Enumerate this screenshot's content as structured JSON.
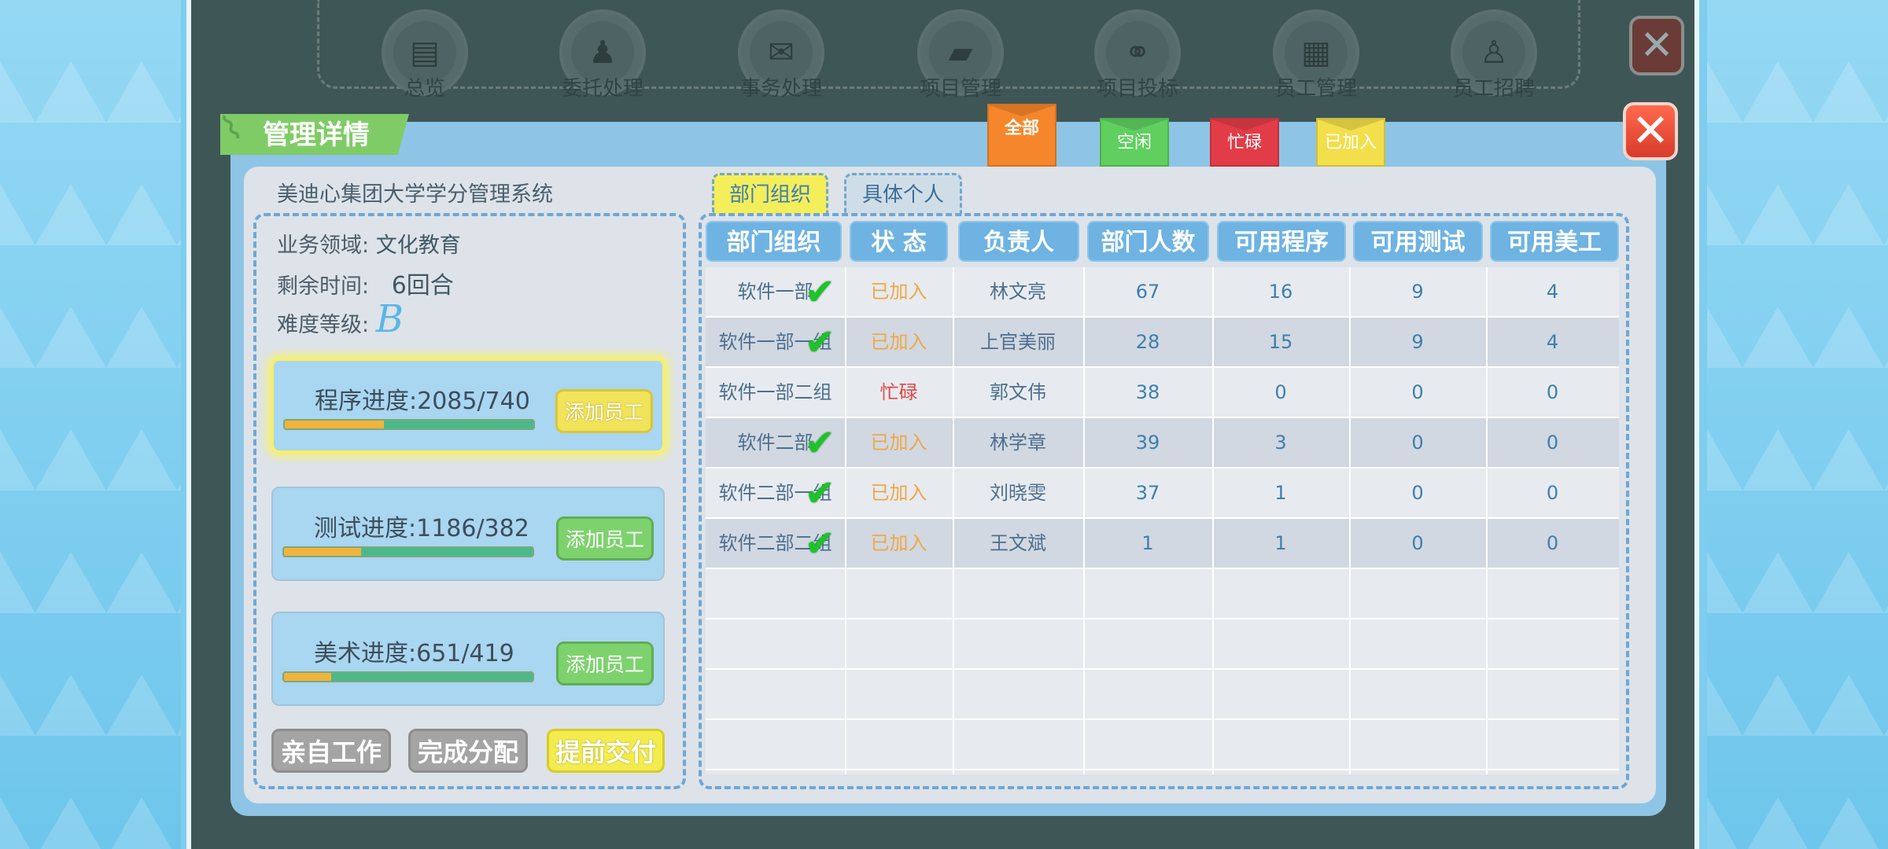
{
  "nav": {
    "items": [
      {
        "label": "总览",
        "icon": "clipboard-icon"
      },
      {
        "label": "委托处理",
        "icon": "businessman-icon"
      },
      {
        "label": "事务处理",
        "icon": "chat-icon"
      },
      {
        "label": "项目管理",
        "icon": "folder-icon"
      },
      {
        "label": "项目投标",
        "icon": "share-icon"
      },
      {
        "label": "员工管理",
        "icon": "id-card-icon"
      },
      {
        "label": "员工招聘",
        "icon": "recruit-icon"
      }
    ]
  },
  "panel": {
    "title": "管理详情",
    "project_name": "美迪心集团大学学分管理系统",
    "close_icon": "✕"
  },
  "filters": {
    "all": "全部",
    "idle": "空闲",
    "busy": "忙碌",
    "joined": "已加入"
  },
  "info": {
    "field_label": "业务领域:",
    "field_value": "文化教育",
    "time_label": "剩余时间:",
    "time_value": "6回合",
    "difficulty_label": "难度等级:",
    "difficulty_value": "B"
  },
  "progress": [
    {
      "label": "程序进度:2085/740",
      "fraction": 0.4,
      "button": "添加员工"
    },
    {
      "label": "测试进度:1186/382",
      "fraction": 0.31,
      "button": "添加员工"
    },
    {
      "label": "美术进度:651/419",
      "fraction": 0.19,
      "button": "添加员工"
    }
  ],
  "actions": {
    "work_self": "亲自工作",
    "finish_assign": "完成分配",
    "deliver_early": "提前交付"
  },
  "tabs": {
    "department": "部门组织",
    "individual": "具体个人"
  },
  "table": {
    "headers": [
      "部门组织",
      "状 态",
      "负责人",
      "部门人数",
      "可用程序",
      "可用测试",
      "可用美工"
    ],
    "rows": [
      {
        "dept": "软件一部",
        "status": "已加入",
        "leader": "林文亮",
        "count": "67",
        "prog": "16",
        "test": "9",
        "art": "4",
        "checked": true
      },
      {
        "dept": "软件一部一组",
        "status": "已加入",
        "leader": "上官美丽",
        "count": "28",
        "prog": "15",
        "test": "9",
        "art": "4",
        "checked": true
      },
      {
        "dept": "软件一部二组",
        "status": "忙碌",
        "leader": "郭文伟",
        "count": "38",
        "prog": "0",
        "test": "0",
        "art": "0",
        "checked": false
      },
      {
        "dept": "软件二部",
        "status": "已加入",
        "leader": "林学章",
        "count": "39",
        "prog": "3",
        "test": "0",
        "art": "0",
        "checked": true
      },
      {
        "dept": "软件二部一组",
        "status": "已加入",
        "leader": "刘晓雯",
        "count": "37",
        "prog": "1",
        "test": "0",
        "art": "0",
        "checked": true
      },
      {
        "dept": "软件二部二组",
        "status": "已加入",
        "leader": "王文斌",
        "count": "1",
        "prog": "1",
        "test": "0",
        "art": "0",
        "checked": true
      }
    ]
  }
}
